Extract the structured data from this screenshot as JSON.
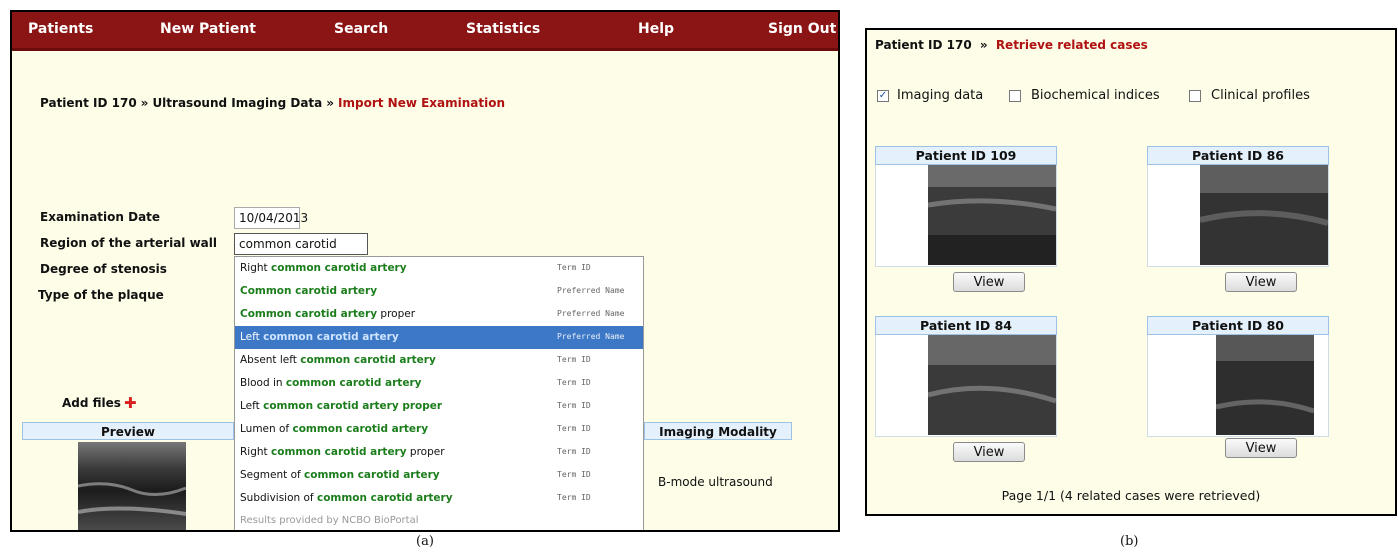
{
  "panel_a": {
    "nav": [
      "Patients",
      "New Patient",
      "Search",
      "Statistics",
      "Help",
      "Sign Out"
    ],
    "breadcrumb": {
      "patient": "Patient ID 170",
      "separator": "»",
      "section": "Ultrasound Imaging Data",
      "current": "Import New Examination"
    },
    "form": {
      "exam_date_label": "Examination Date",
      "exam_date_value": "10/04/2013",
      "region_label": "Region of the arterial wall",
      "region_value": "common carotid artery",
      "stenosis_label": "Degree of stenosis",
      "plaque_label": "Type of the plaque"
    },
    "autocomplete": {
      "items": [
        {
          "pre": "Right ",
          "match": "common carotid artery",
          "post": "",
          "type": "Term ID"
        },
        {
          "pre": "",
          "match": "Common carotid artery",
          "post": "",
          "type": "Preferred Name"
        },
        {
          "pre": "",
          "match": "Common carotid artery",
          "post": " proper",
          "type": "Preferred Name"
        },
        {
          "pre": "Left ",
          "match": "common carotid artery",
          "post": "",
          "type": "Preferred Name"
        },
        {
          "pre": "Absent left ",
          "match": "common carotid artery",
          "post": "",
          "type": "Term ID"
        },
        {
          "pre": "Blood in ",
          "match": "common carotid artery",
          "post": "",
          "type": "Term ID"
        },
        {
          "pre": "Left ",
          "match": "common carotid artery proper",
          "post": "",
          "type": "Term ID"
        },
        {
          "pre": "Lumen of ",
          "match": "common carotid artery",
          "post": "",
          "type": "Term ID"
        },
        {
          "pre": "Right ",
          "match": "common carotid artery",
          "post": " proper",
          "type": "Term ID"
        },
        {
          "pre": "Segment of ",
          "match": "common carotid artery",
          "post": "",
          "type": "Term ID"
        },
        {
          "pre": "Subdivision of ",
          "match": "common carotid artery",
          "post": "",
          "type": "Term ID"
        }
      ],
      "footer": "Results provided by NCBO BioPortal"
    },
    "add_files": "Add files",
    "table_headers": {
      "preview": "Preview",
      "modality": "Imaging Modality"
    },
    "modality_value": "B-mode ultrasound"
  },
  "panel_b": {
    "breadcrumb": {
      "patient": "Patient ID 170",
      "separator": "»",
      "current": "Retrieve related cases"
    },
    "filters": [
      {
        "label": "Imaging data",
        "checked": true
      },
      {
        "label": "Biochemical indices",
        "checked": false
      },
      {
        "label": "Clinical profiles",
        "checked": false
      }
    ],
    "cases": [
      "Patient ID 109",
      "Patient ID 86",
      "Patient ID 84",
      "Patient ID 80"
    ],
    "view_label": "View",
    "page_info": "Page 1/1 (4 related cases were retrieved)"
  },
  "captions": {
    "a": "(a)",
    "b": "(b)"
  },
  "colors": {
    "nav": "#8b1414",
    "accent_red": "#b01212",
    "match_green": "#1b7d1b",
    "selected": "#3c78c6"
  }
}
